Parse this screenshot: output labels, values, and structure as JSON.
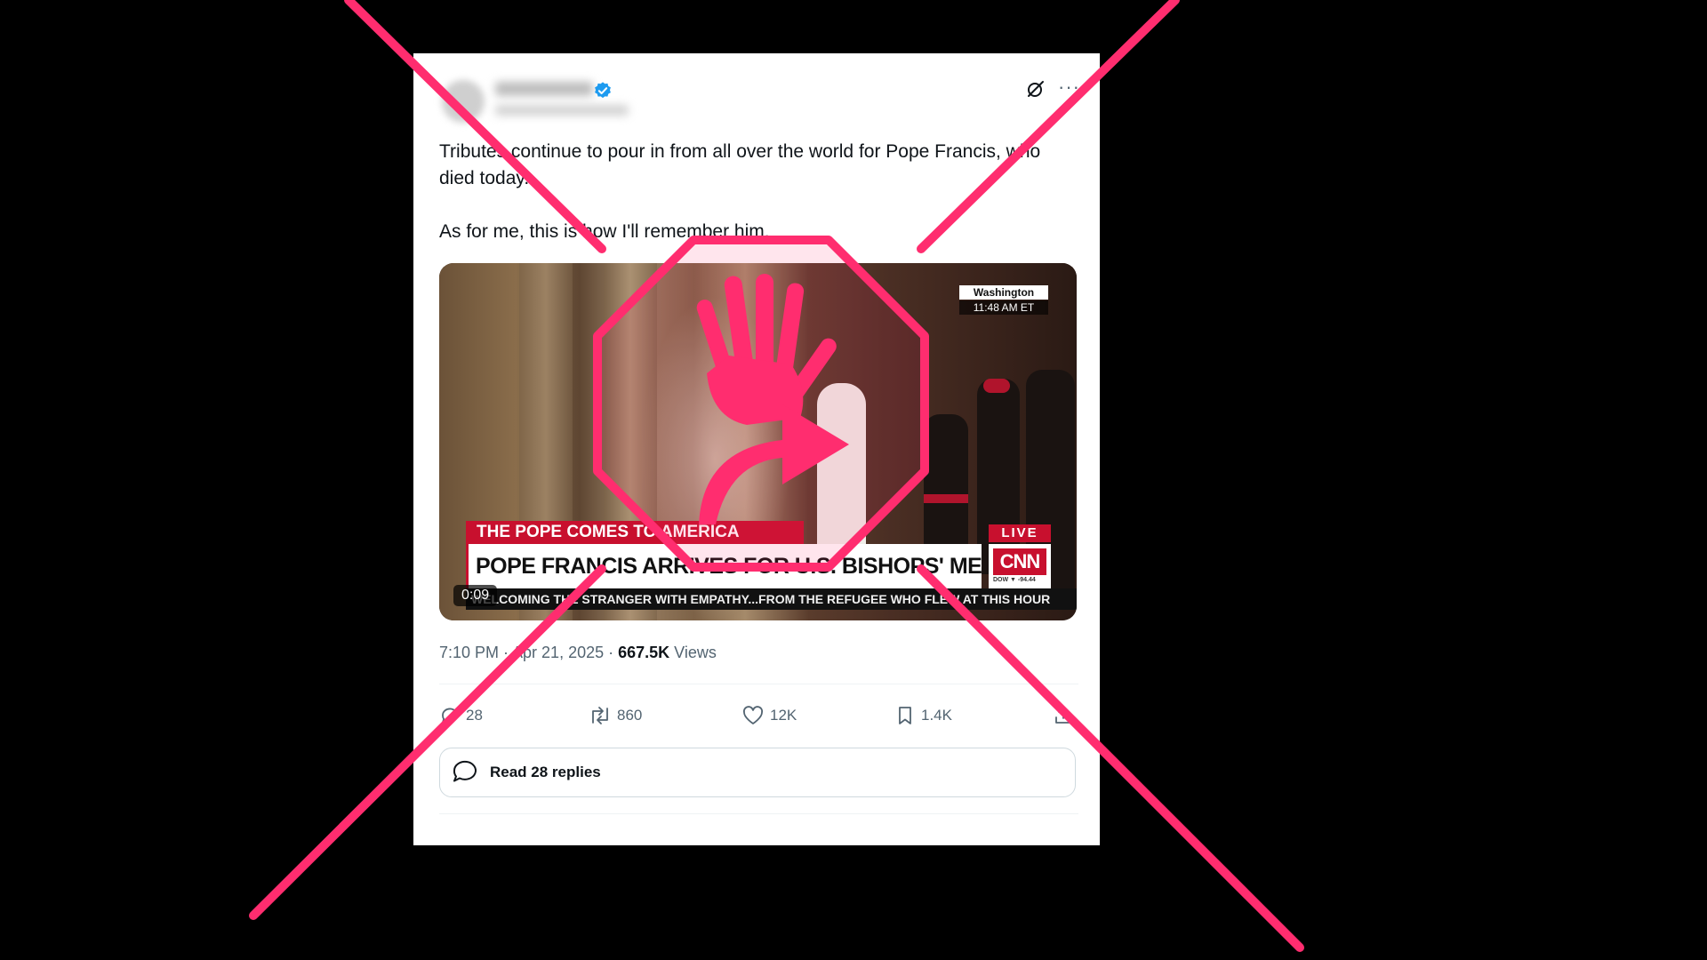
{
  "tweet": {
    "text_line1": "Tributes continue to pour in from all over the world for Pope Francis, who died today.",
    "text_line2": "As for me, this is how I'll remember him.",
    "timestamp": "7:10 PM · Apr 21, 2025 · ",
    "views_count": "667.5K",
    "views_label": " Views"
  },
  "video": {
    "location": "Washington",
    "time": "11:48 AM ET",
    "chyron_top": "THE POPE COMES TO AMERICA",
    "chyron_main": "POPE FRANCIS ARRIVES FOR U.S. BISHOPS' MEETING",
    "live_label": "LIVE",
    "network": "CNN",
    "dow": "DOW ▼ -94.44",
    "ticker": "WELCOMING THE STRANGER WITH EMPATHY...FROM THE REFUGEE WHO FLEW AT THIS HOUR",
    "duration": "0:09"
  },
  "actions": {
    "replies": "28",
    "reposts": "860",
    "likes": "12K",
    "bookmarks": "1.4K"
  },
  "read_replies": "Read 28 replies",
  "colors": {
    "overlay_pink": "#ff2d6f",
    "verified_blue": "#1d9bf0",
    "cnn_red": "#c8102e"
  },
  "icons": [
    "verified-badge-icon",
    "grok-icon",
    "more-icon",
    "reply-icon",
    "repost-icon",
    "like-icon",
    "bookmark-icon",
    "share-icon",
    "replies-bubble-icon",
    "stop-hand-icon"
  ]
}
